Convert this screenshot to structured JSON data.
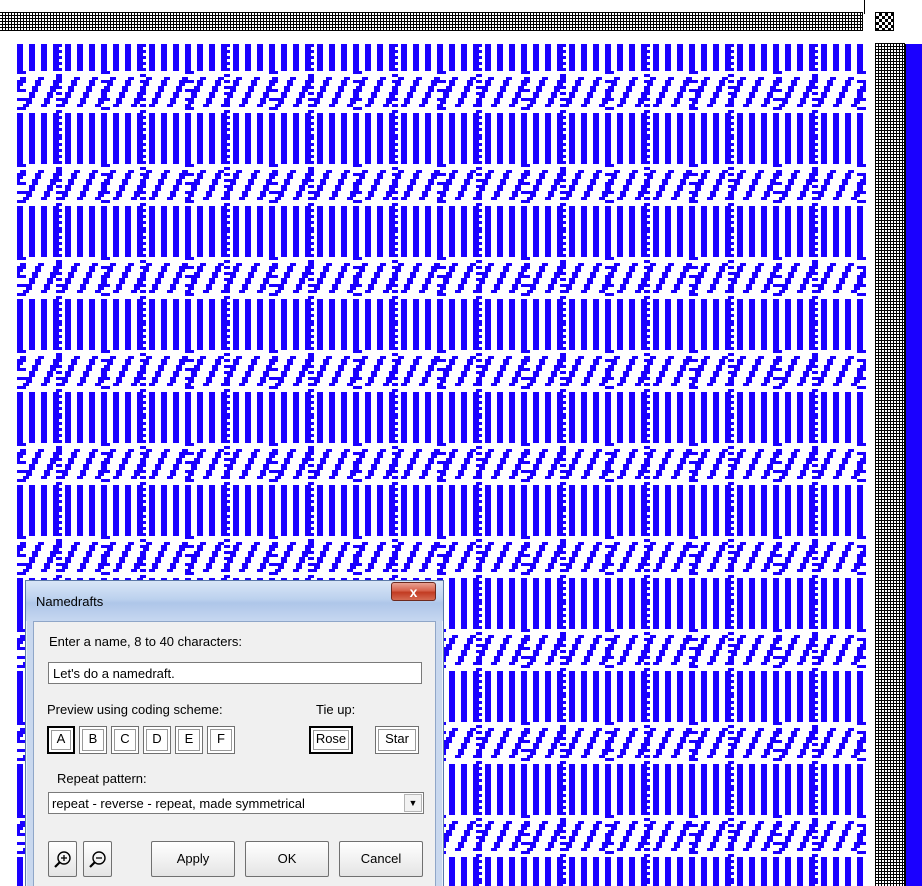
{
  "colors": {
    "weave_color": "#1a00ff",
    "background": "#ffffff",
    "grid_line": "#000000"
  },
  "dialog": {
    "title": "Namedrafts",
    "close_label": "x",
    "name_prompt": "Enter a name, 8 to 40 characters:",
    "name_value": "Let's do a namedraft.",
    "preview_label": "Preview using coding scheme:",
    "tieup_label": "Tie up:",
    "coding_schemes": [
      "A",
      "B",
      "C",
      "D",
      "E",
      "F"
    ],
    "selected_scheme": "A",
    "tieup_options": [
      "Rose",
      "Star"
    ],
    "selected_tieup": "Rose",
    "repeat_label": "Repeat pattern:",
    "repeat_value": "repeat - reverse - repeat, made symmetrical",
    "buttons": {
      "zoom_in_icon": "zoom-in-icon",
      "zoom_out_icon": "zoom-out-icon",
      "apply": "Apply",
      "ok": "OK",
      "cancel": "Cancel"
    }
  }
}
